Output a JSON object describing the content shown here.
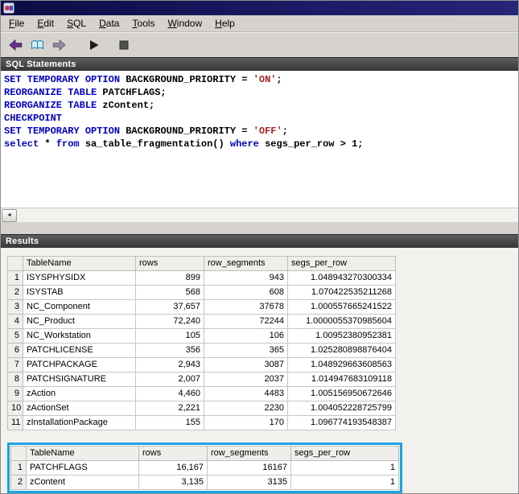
{
  "window": {
    "title": ""
  },
  "menu": {
    "items": [
      {
        "label": "File",
        "accel": 0
      },
      {
        "label": "Edit",
        "accel": 0
      },
      {
        "label": "SQL",
        "accel": 0
      },
      {
        "label": "Data",
        "accel": 0
      },
      {
        "label": "Tools",
        "accel": 0
      },
      {
        "label": "Window",
        "accel": 0
      },
      {
        "label": "Help",
        "accel": 0
      }
    ]
  },
  "toolbar": {
    "buttons": [
      {
        "name": "back",
        "icon": "arrow-left"
      },
      {
        "name": "recall",
        "icon": "book"
      },
      {
        "name": "forward",
        "icon": "arrow-right"
      },
      {
        "name": "execute",
        "icon": "play"
      },
      {
        "name": "interrupt",
        "icon": "stop"
      }
    ]
  },
  "icons": {
    "scroll_left": "◄"
  },
  "sql_panel": {
    "header": "SQL Statements",
    "lines": [
      [
        {
          "t": "SET TEMPORARY OPTION",
          "c": "kw"
        },
        {
          "t": " BACKGROUND_PRIORITY = ",
          "c": "id"
        },
        {
          "t": "'ON'",
          "c": "str"
        },
        {
          "t": ";",
          "c": "id"
        }
      ],
      [
        {
          "t": "REORGANIZE TABLE",
          "c": "kw"
        },
        {
          "t": " PATCHFLAGS;",
          "c": "id"
        }
      ],
      [
        {
          "t": "REORGANIZE TABLE",
          "c": "kw"
        },
        {
          "t": " zContent;",
          "c": "id"
        }
      ],
      [
        {
          "t": "CHECKPOINT",
          "c": "kw"
        }
      ],
      [
        {
          "t": "SET TEMPORARY OPTION",
          "c": "kw"
        },
        {
          "t": " BACKGROUND_PRIORITY = ",
          "c": "id"
        },
        {
          "t": "'OFF'",
          "c": "str"
        },
        {
          "t": ";",
          "c": "id"
        }
      ],
      [
        {
          "t": "select",
          "c": "kw"
        },
        {
          "t": " * ",
          "c": "id"
        },
        {
          "t": "from",
          "c": "kw"
        },
        {
          "t": " sa_table_fragmentation() ",
          "c": "id"
        },
        {
          "t": "where",
          "c": "kw"
        },
        {
          "t": " segs_per_row > 1;",
          "c": "id"
        }
      ]
    ]
  },
  "results_panel": {
    "header": "Results"
  },
  "main_table": {
    "columns": [
      "TableName",
      "rows",
      "row_segments",
      "segs_per_row"
    ],
    "rows": [
      {
        "num": "1",
        "name": "ISYSPHYSIDX",
        "rows": "899",
        "row_segments": "943",
        "segs_per_row": "1.048943270300334"
      },
      {
        "num": "2",
        "name": "ISYSTAB",
        "rows": "568",
        "row_segments": "608",
        "segs_per_row": "1.070422535211268"
      },
      {
        "num": "3",
        "name": "NC_Component",
        "rows": "37,657",
        "row_segments": "37678",
        "segs_per_row": "1.000557665241522"
      },
      {
        "num": "4",
        "name": "NC_Product",
        "rows": "72,240",
        "row_segments": "72244",
        "segs_per_row": "1.0000055370985604"
      },
      {
        "num": "5",
        "name": "NC_Workstation",
        "rows": "105",
        "row_segments": "106",
        "segs_per_row": "1.00952380952381"
      },
      {
        "num": "6",
        "name": "PATCHLICENSE",
        "rows": "356",
        "row_segments": "365",
        "segs_per_row": "1.025280898876404"
      },
      {
        "num": "7",
        "name": "PATCHPACKAGE",
        "rows": "2,943",
        "row_segments": "3087",
        "segs_per_row": "1.048929663608563"
      },
      {
        "num": "8",
        "name": "PATCHSIGNATURE",
        "rows": "2,007",
        "row_segments": "2037",
        "segs_per_row": "1.014947683109118"
      },
      {
        "num": "9",
        "name": "zAction",
        "rows": "4,460",
        "row_segments": "4483",
        "segs_per_row": "1.005156950672646"
      },
      {
        "num": "10",
        "name": "zActionSet",
        "rows": "2,221",
        "row_segments": "2230",
        "segs_per_row": "1.004052228725799"
      },
      {
        "num": "11",
        "name": "zInstallationPackage",
        "rows": "155",
        "row_segments": "170",
        "segs_per_row": "1.096774193548387"
      }
    ]
  },
  "highlight_table": {
    "columns": [
      "TableName",
      "rows",
      "row_segments",
      "segs_per_row"
    ],
    "rows": [
      {
        "num": "1",
        "name": "PATCHFLAGS",
        "rows": "16,167",
        "row_segments": "16167",
        "segs_per_row": "1"
      },
      {
        "num": "2",
        "name": "zContent",
        "rows": "3,135",
        "row_segments": "3135",
        "segs_per_row": "1"
      }
    ]
  },
  "colors": {
    "keyword": "#0000cc",
    "string": "#aa2222",
    "highlight_border": "#1aa3e2",
    "titlebar": "#14144e"
  }
}
